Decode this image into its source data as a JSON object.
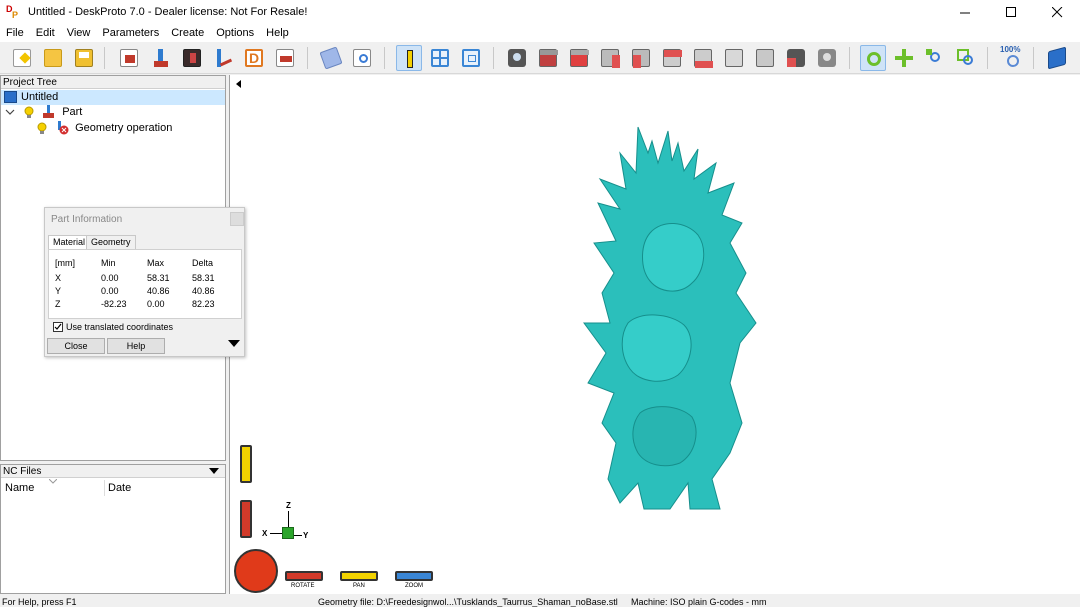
{
  "window": {
    "title": "Untitled - DeskProto 7.0 - Dealer license: Not For Resale!"
  },
  "menu": [
    "File",
    "Edit",
    "View",
    "Parameters",
    "Create",
    "Options",
    "Help"
  ],
  "toolbar": {
    "zoom_label": "100%"
  },
  "project_tree": {
    "header": "Project Tree",
    "items": [
      {
        "label": "Untitled"
      },
      {
        "label": "Part"
      },
      {
        "label": "Geometry operation"
      }
    ]
  },
  "nc_files": {
    "header": "NC Files",
    "columns": [
      "Name",
      "Date"
    ]
  },
  "part_info": {
    "title": "Part Information",
    "tabs": [
      "Material",
      "Geometry"
    ],
    "headers": [
      "[mm]",
      "Min",
      "Max",
      "Delta"
    ],
    "rows": [
      {
        "axis": "X",
        "min": "0.00",
        "max": "58.31",
        "delta": "58.31"
      },
      {
        "axis": "Y",
        "min": "0.00",
        "max": "40.86",
        "delta": "40.86"
      },
      {
        "axis": "Z",
        "min": "-82.23",
        "max": "0.00",
        "delta": "82.23"
      }
    ],
    "checkbox_label": "Use translated coordinates",
    "close_label": "Close",
    "help_label": "Help"
  },
  "viewport": {
    "axis_labels": {
      "z": "Z",
      "x": "X",
      "y": "Y"
    },
    "controls": {
      "rotate": "ROTATE",
      "pan": "PAN",
      "zoom": "ZOOM"
    },
    "model_color": "#2bbfbb"
  },
  "status": {
    "help": "For Help, press F1",
    "geometry": "Geometry file: D:\\Freedesignwol...\\Tusklands_Taurrus_Shaman_noBase.stl",
    "machine": "Machine: ISO plain G-codes - mm"
  }
}
